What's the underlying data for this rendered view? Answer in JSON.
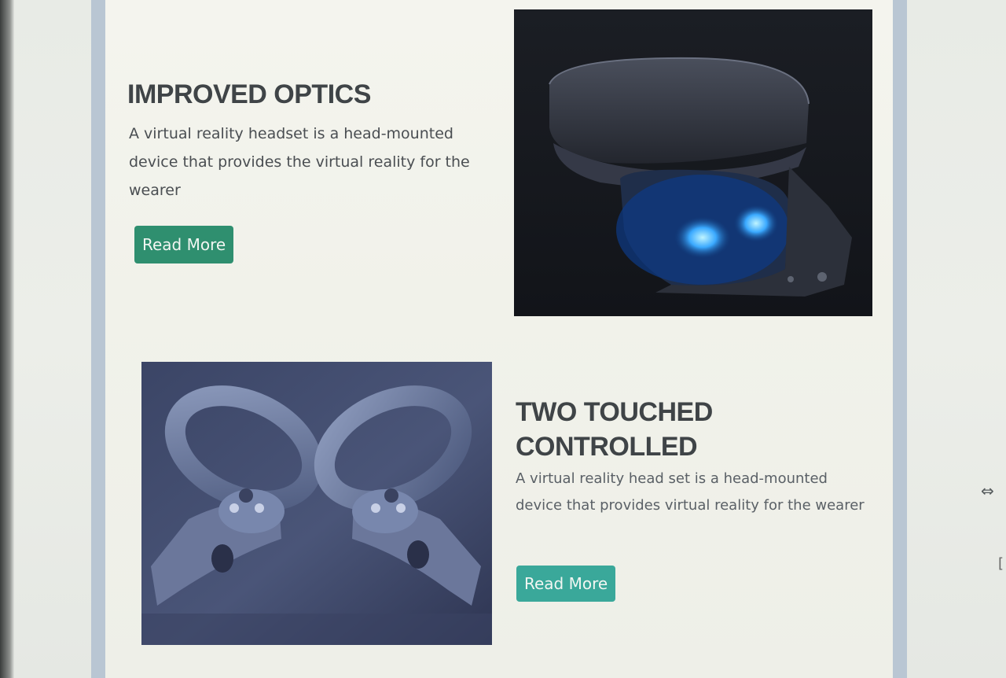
{
  "sections": [
    {
      "title": "IMPROVED OPTICS",
      "description": "A virtual reality headset is a head-mounted device that provides the virtual reality for the wearer",
      "button_label": "Read More",
      "image_icon": "vr-headset-image",
      "button_color": "#2f8f6f"
    },
    {
      "title": "TWO TOUCHED CONTROLLED",
      "description": "A virtual reality head set is a head-mounted device that provides virtual reality for the wearer",
      "button_label": "Read More",
      "image_icon": "vr-controllers-image",
      "button_color": "#3aa89a"
    }
  ],
  "cursor_icon": "resize-horizontal-icon"
}
